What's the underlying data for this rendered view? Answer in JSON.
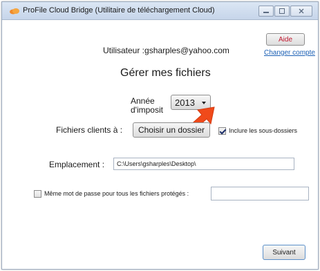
{
  "window": {
    "title": "ProFile Cloud Bridge (Utilitaire de téléchargement Cloud)"
  },
  "header": {
    "help_label": "Aide",
    "user_text": "Utilisateur :gsharples@yahoo.com",
    "change_account_label": "Changer compte"
  },
  "main": {
    "heading": "Gérer mes fichiers",
    "tax_year_label_line1": "Année",
    "tax_year_label_line2": "d'imposit",
    "tax_year_value": "2013",
    "client_files_label": "Fichiers clients à :",
    "choose_folder_label": "Choisir un dossier",
    "include_subfolders_label": "Inclure les sous-dossiers",
    "include_subfolders_checked": true,
    "location_label": "Emplacement :",
    "location_value": "C:\\Users\\gsharples\\Desktop\\",
    "same_password_label": "Même mot de passe pour tous les fichiers protégés :",
    "same_password_checked": false,
    "password_value": "",
    "next_label": "Suivant"
  },
  "colors": {
    "arrow": "#f04a1a",
    "link": "#1a5fb4",
    "help_text": "#c0182f"
  },
  "icons": {
    "app": "cloud-icon",
    "minimize": "minimize-icon",
    "maximize": "maximize-icon",
    "close": "close-icon",
    "pointer": "arrow-pointer-icon"
  }
}
